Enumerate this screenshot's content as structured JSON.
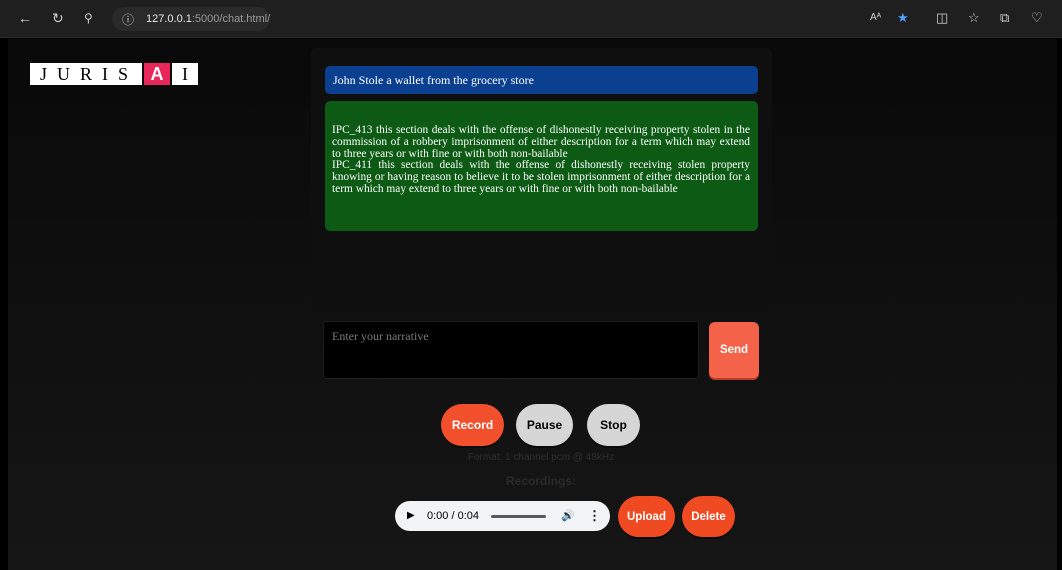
{
  "browser": {
    "url_host": "127.0.0.1",
    "url_rest": ":5000/chat.html/",
    "reader_label": "Aᴬ"
  },
  "logo": {
    "text_white": "JURIS",
    "text_accent": "A",
    "text_end": "I"
  },
  "chat": {
    "user_message": "John Stole a wallet from the grocery store",
    "bot_lines": [
      "IPC_413 this section deals with the offense of dishonestly receiving property stolen in the commission of a robbery imprisonment of either description for a term which may extend to three years or with fine or with both non-bailable",
      "IPC_411 this section deals with the offense of dishonestly receiving stolen property knowing or having reason to believe it to be stolen imprisonment of either description for a term which may extend to three years or with fine or with both non-bailable"
    ]
  },
  "input": {
    "placeholder": "Enter your narrative",
    "send_label": "Send"
  },
  "recorder": {
    "record_label": "Record",
    "pause_label": "Pause",
    "stop_label": "Stop",
    "format_text": "Format: 1 channel pcm @ 48kHz",
    "recordings_label": "Recordings:"
  },
  "audio_player": {
    "time": "0:00 / 0:04",
    "progress": 0
  },
  "actions": {
    "upload_label": "Upload",
    "delete_label": "Delete"
  },
  "colors": {
    "user_bubble": "#0b4090",
    "bot_bubble": "#0c5a14",
    "accent": "#f04a22",
    "logo_accent": "#e8285a"
  }
}
